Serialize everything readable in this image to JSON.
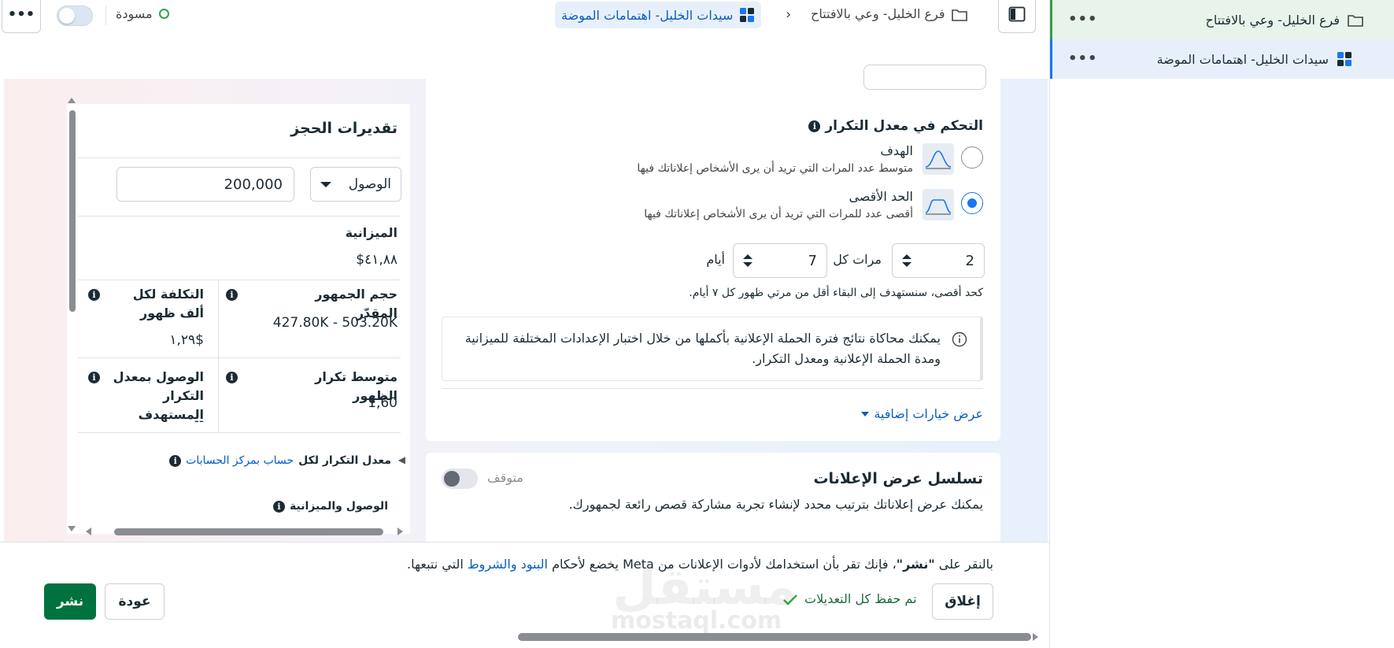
{
  "sidebar": {
    "campaign_label": "فرع الخليل- وعي بالافتتاح",
    "adset_label": "سيدات الخليل- اهتمامات الموضة",
    "more": "•••"
  },
  "topbar": {
    "more": "•••",
    "status": "مسودة",
    "breadcrumb_adset": "سيدات الخليل- اهتمامات الموضة",
    "breadcrumb_campaign": "فرع الخليل- وعي بالافتتاح",
    "chevron": "›"
  },
  "estimates": {
    "title": "تقديرات الحجز",
    "metric": "الوصول",
    "reach_value": "200,000",
    "budget_label": "الميزانية",
    "budget_value": "$٤١,٨٨",
    "audience_label": "حجم الجمهور المقدّر",
    "audience_value": "427.80K - 503.20K",
    "cpm_label": "التكلفة لكل ألف ظهور",
    "cpm_value": "$١,٢٩",
    "avg_freq_label": "متوسط تكرار الظهور",
    "avg_freq_value": "1,60",
    "target_reach_label": "الوصول بمعدل التكرار المستهدف",
    "target_reach_value": "--",
    "freq_account_prefix": "معدل التكرار لكل",
    "freq_account_link": "حساب بمركز الحسابات",
    "reach_budget_label": "الوصول والميزانية"
  },
  "frequency": {
    "title": "التحكم في معدل التكرار",
    "target_title": "الهدف",
    "target_desc": "متوسط عدد المرات التي تريد أن يرى الأشخاص إعلاناتك فيها",
    "cap_title": "الحد الأقصى",
    "cap_desc": "أقصى عدد للمرات التي تريد أن يرى الأشخاص إعلاناتك فيها",
    "times_value": "2",
    "times_label": "مرات كل",
    "days_value": "7",
    "days_label": "أيام",
    "note": "كحد أقصى، سنستهدف إلى البقاء أقل من مرتي ظهور كل ٧ أيام.",
    "simulation_text": "يمكنك محاكاة نتائج فترة الحملة الإعلانية بأكملها من خلال اختبار الإعدادات المختلفة للميزانية ومدة الحملة الإعلانية ومعدل التكرار.",
    "more_options": "عرض خيارات إضافية"
  },
  "sequence": {
    "title": "تسلسل عرض الإعلانات",
    "status": "متوقف",
    "description": "يمكنك عرض إعلاناتك بترتيب محدد لإنشاء تجربة مشاركة قصص رائعة لجمهورك."
  },
  "footer": {
    "legal_1": "بالنقر على ",
    "legal_bold": "\"نشر\"",
    "legal_2": "، فإنك تقر بأن استخدامك لأدوات الإعلانات من Meta يخضع لأحكام ",
    "legal_link": "البنود والشروط",
    "legal_3": " التي نتبعها.",
    "close": "إغلاق",
    "saved": "تم حفظ كل التعديلات",
    "back": "عودة",
    "publish": "نشر",
    "watermark_ar": "مستقل",
    "watermark_en": "mostaql.com"
  },
  "colors": {
    "accent": "#1877f2",
    "link": "#0a5dc2",
    "publish": "#00723f",
    "success": "#31a24c"
  },
  "icons": [
    "folder-icon",
    "grid-icon",
    "sidebar-panel-icon",
    "info-icon",
    "check-icon",
    "status-ring-icon"
  ]
}
